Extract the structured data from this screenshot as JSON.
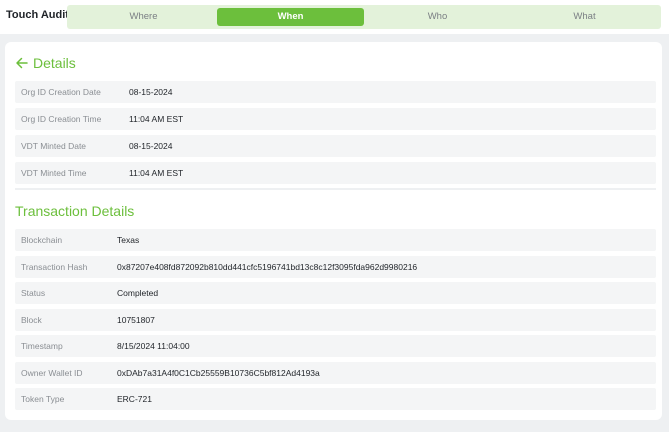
{
  "header": {
    "title": "Touch Audit",
    "tabs": [
      {
        "label": "Where",
        "active": false
      },
      {
        "label": "When",
        "active": true
      },
      {
        "label": "Who",
        "active": false
      },
      {
        "label": "What",
        "active": false
      }
    ]
  },
  "details": {
    "title": "Details",
    "rows": [
      {
        "label": "Org ID Creation Date",
        "value": "08-15-2024"
      },
      {
        "label": "Org ID Creation Time",
        "value": "11:04 AM EST"
      },
      {
        "label": "VDT Minted Date",
        "value": "08-15-2024"
      },
      {
        "label": "VDT Minted Time",
        "value": "11:04 AM EST"
      }
    ]
  },
  "transaction": {
    "title": "Transaction Details",
    "rows": [
      {
        "label": "Blockchain",
        "value": "Texas"
      },
      {
        "label": "Transaction Hash",
        "value": "0x87207e408fd872092b810dd441cfc5196741bd13c8c12f3095fda962d9980216"
      },
      {
        "label": "Status",
        "value": "Completed"
      },
      {
        "label": "Block",
        "value": "10751807"
      },
      {
        "label": "Timestamp",
        "value": "8/15/2024 11:04:00"
      },
      {
        "label": "Owner Wallet ID",
        "value": "0xDAb7a31A4f0C1Cb25559B10736C5bf812Ad4193a"
      },
      {
        "label": "Token Type",
        "value": "ERC-721"
      }
    ]
  },
  "colors": {
    "accent": "#6cbf3c",
    "tab_bg": "#e3f2da",
    "row_bg": "#f4f5f6",
    "page_bg": "#eef0f2"
  },
  "icons": {
    "back": "arrow-left-icon"
  }
}
